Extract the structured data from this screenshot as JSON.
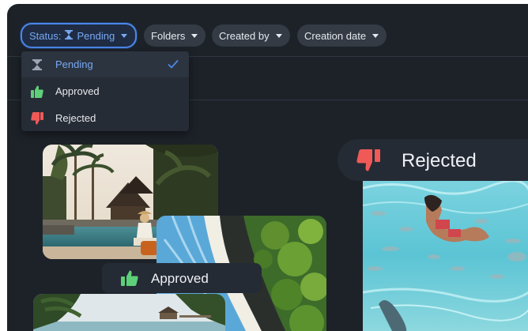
{
  "filters": {
    "status": {
      "prefix": "Status:",
      "value": "Pending"
    },
    "folders": "Folders",
    "created_by": "Created by",
    "creation_date": "Creation date"
  },
  "status_options": [
    {
      "label": "Pending",
      "icon": "hourglass-icon",
      "selected": true
    },
    {
      "label": "Approved",
      "icon": "thumbs-up-icon",
      "selected": false
    },
    {
      "label": "Rejected",
      "icon": "thumbs-down-icon",
      "selected": false
    }
  ],
  "cards": {
    "approved_label": "Approved",
    "rejected_label": "Rejected"
  },
  "colors": {
    "accent": "#4c87e8",
    "approved": "#5fd07a",
    "rejected": "#ef5a57",
    "background": "#1d2229"
  }
}
